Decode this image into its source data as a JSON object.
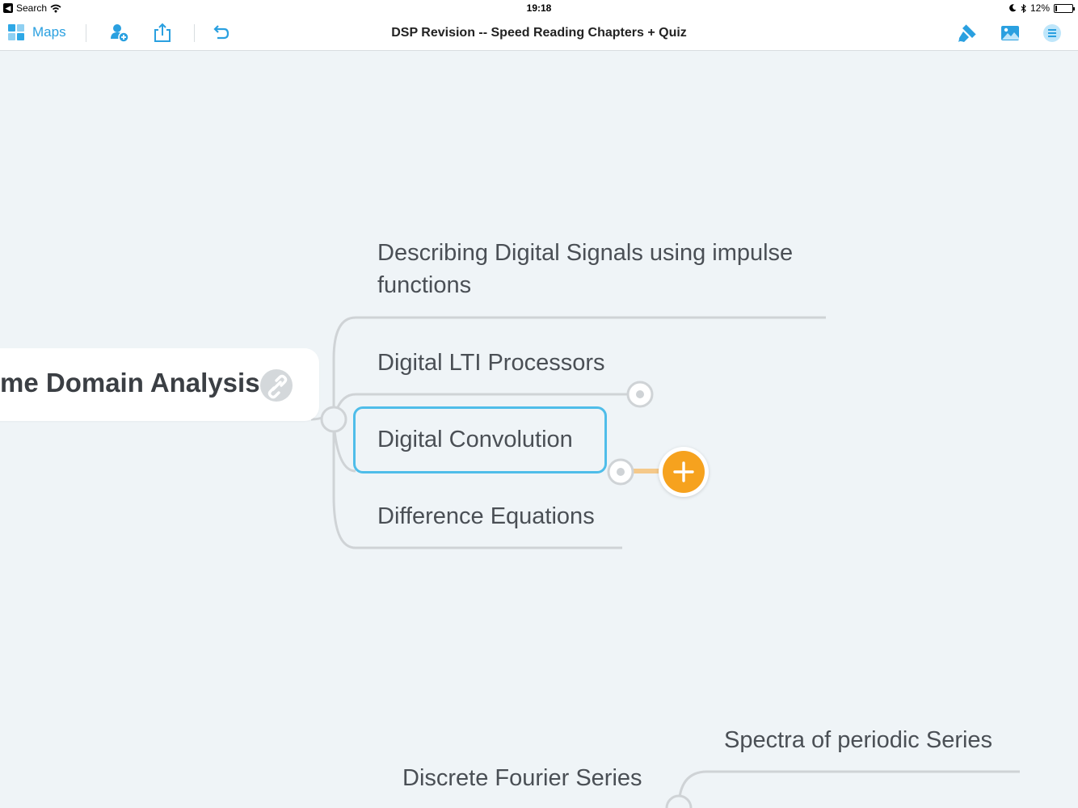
{
  "status_bar": {
    "back_app": "Search",
    "time": "19:18",
    "battery_percent": "12%",
    "battery_level": 0.12
  },
  "toolbar": {
    "maps_label": "Maps",
    "title": "DSP Revision -- Speed Reading Chapters + Quiz",
    "icons": [
      "maps-grid-icon",
      "add-collaborator-icon",
      "share-icon",
      "undo-icon",
      "style-brush-icon",
      "insert-image-icon",
      "outline-menu-icon"
    ],
    "accent_color": "#2aa0e0"
  },
  "map": {
    "central_topic": "me Domain Analysis",
    "topics": [
      "Describing Digital Signals using impulse functions",
      "Digital LTI Processors",
      "Digital Convolution",
      "Difference Equations"
    ],
    "selected_topic": "Digital Convolution",
    "selection_color": "#4fbde9",
    "add_button_color": "#f6a21e",
    "second_branch": {
      "topic": "Discrete Fourier Series",
      "subtopics": [
        "Spectra of periodic Series"
      ]
    }
  }
}
